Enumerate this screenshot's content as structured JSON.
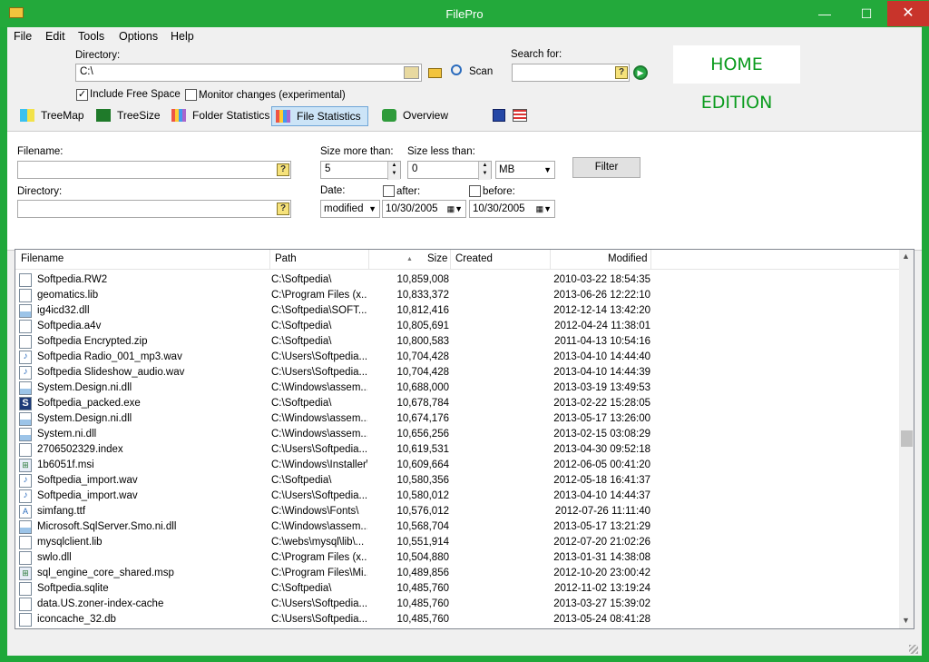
{
  "window": {
    "title": "FilePro",
    "minimize": "—",
    "maximize": "☐",
    "close": "✕"
  },
  "menu": [
    "File",
    "Edit",
    "Tools",
    "Options",
    "Help"
  ],
  "toolbar": {
    "directory_label": "Directory:",
    "directory_value": "C:\\",
    "scan_label": "Scan",
    "search_label": "Search for:",
    "search_value": "",
    "include_free_space": "Include Free Space",
    "monitor_changes": "Monitor changes (experimental)",
    "home_edition": "HOME EDITION"
  },
  "tabs": [
    {
      "label": "TreeMap",
      "active": false
    },
    {
      "label": "TreeSize",
      "active": false
    },
    {
      "label": "Folder Statistics",
      "active": false
    },
    {
      "label": "File Statistics",
      "active": true
    },
    {
      "label": "Overview",
      "active": false
    }
  ],
  "filter": {
    "filename_label": "Filename:",
    "filename_value": "",
    "directory_label": "Directory:",
    "directory_value": "",
    "size_more_label": "Size more than:",
    "size_more_value": "5",
    "size_less_label": "Size less than:",
    "size_less_value": "0",
    "unit": "MB",
    "filter_button": "Filter",
    "date_label": "Date:",
    "date_mode": "modified",
    "after_label": "after:",
    "after_date": "10/30/2005",
    "before_label": "before:",
    "before_date": "10/30/2005",
    "question_mark": "?"
  },
  "table": {
    "columns": [
      "Filename",
      "Path",
      "Size",
      "Created",
      "Modified"
    ],
    "rows": [
      {
        "icon": "file",
        "name": "Softpedia.RW2",
        "path": "C:\\Softpedia\\",
        "size": "10,859,008",
        "created": "",
        "modified": "2010-03-22 18:54:35"
      },
      {
        "icon": "file",
        "name": "geomatics.lib",
        "path": "C:\\Program Files (x...",
        "size": "10,833,372",
        "created": "",
        "modified": "2013-06-26 12:22:10"
      },
      {
        "icon": "dll",
        "name": "ig4icd32.dll",
        "path": "C:\\Softpedia\\SOFT...",
        "size": "10,812,416",
        "created": "",
        "modified": "2012-12-14 13:42:20"
      },
      {
        "icon": "file",
        "name": "Softpedia.a4v",
        "path": "C:\\Softpedia\\",
        "size": "10,805,691",
        "created": "",
        "modified": "2012-04-24 11:38:01"
      },
      {
        "icon": "file",
        "name": "Softpedia Encrypted.zip",
        "path": "C:\\Softpedia\\",
        "size": "10,800,583",
        "created": "",
        "modified": "2011-04-13 10:54:16"
      },
      {
        "icon": "audio",
        "name": "Softpedia Radio_001_mp3.wav",
        "path": "C:\\Users\\Softpedia...",
        "size": "10,704,428",
        "created": "",
        "modified": "2013-04-10 14:44:40"
      },
      {
        "icon": "audio",
        "name": "Softpedia Slideshow_audio.wav",
        "path": "C:\\Users\\Softpedia...",
        "size": "10,704,428",
        "created": "",
        "modified": "2013-04-10 14:44:39"
      },
      {
        "icon": "dll",
        "name": "System.Design.ni.dll",
        "path": "C:\\Windows\\assem...",
        "size": "10,688,000",
        "created": "",
        "modified": "2013-03-19 13:49:53"
      },
      {
        "icon": "exe",
        "name": "Softpedia_packed.exe",
        "path": "C:\\Softpedia\\",
        "size": "10,678,784",
        "created": "",
        "modified": "2013-02-22 15:28:05"
      },
      {
        "icon": "dll",
        "name": "System.Design.ni.dll",
        "path": "C:\\Windows\\assem...",
        "size": "10,674,176",
        "created": "",
        "modified": "2013-05-17 13:26:00"
      },
      {
        "icon": "dll",
        "name": "System.ni.dll",
        "path": "C:\\Windows\\assem...",
        "size": "10,656,256",
        "created": "",
        "modified": "2013-02-15 03:08:29"
      },
      {
        "icon": "file",
        "name": "2706502329.index",
        "path": "C:\\Users\\Softpedia...",
        "size": "10,619,531",
        "created": "",
        "modified": "2013-04-30 09:52:18"
      },
      {
        "icon": "msi",
        "name": "1b6051f.msi",
        "path": "C:\\Windows\\Installer\\",
        "size": "10,609,664",
        "created": "",
        "modified": "2012-06-05 00:41:20"
      },
      {
        "icon": "audio",
        "name": "Softpedia_import.wav",
        "path": "C:\\Softpedia\\",
        "size": "10,580,356",
        "created": "",
        "modified": "2012-05-18 16:41:37"
      },
      {
        "icon": "audio",
        "name": "Softpedia_import.wav",
        "path": "C:\\Users\\Softpedia...",
        "size": "10,580,012",
        "created": "",
        "modified": "2013-04-10 14:44:37"
      },
      {
        "icon": "font",
        "name": "simfang.ttf",
        "path": "C:\\Windows\\Fonts\\",
        "size": "10,576,012",
        "created": "",
        "modified": "2012-07-26 11:11:40"
      },
      {
        "icon": "dll",
        "name": "Microsoft.SqlServer.Smo.ni.dll",
        "path": "C:\\Windows\\assem...",
        "size": "10,568,704",
        "created": "",
        "modified": "2013-05-17 13:21:29"
      },
      {
        "icon": "file",
        "name": "mysqlclient.lib",
        "path": "C:\\webs\\mysql\\lib\\...",
        "size": "10,551,914",
        "created": "",
        "modified": "2012-07-20 21:02:26"
      },
      {
        "icon": "file",
        "name": "swlo.dll",
        "path": "C:\\Program Files (x...",
        "size": "10,504,880",
        "created": "",
        "modified": "2013-01-31 14:38:08"
      },
      {
        "icon": "msi",
        "name": "sql_engine_core_shared.msp",
        "path": "C:\\Program Files\\Mi...",
        "size": "10,489,856",
        "created": "",
        "modified": "2012-10-20 23:00:42"
      },
      {
        "icon": "file",
        "name": "Softpedia.sqlite",
        "path": "C:\\Softpedia\\",
        "size": "10,485,760",
        "created": "",
        "modified": "2012-11-02 13:19:24"
      },
      {
        "icon": "file",
        "name": "data.US.zoner-index-cache",
        "path": "C:\\Users\\Softpedia...",
        "size": "10,485,760",
        "created": "",
        "modified": "2013-03-27 15:39:02"
      },
      {
        "icon": "file",
        "name": "iconcache_32.db",
        "path": "C:\\Users\\Softpedia...",
        "size": "10,485,760",
        "created": "",
        "modified": "2013-05-24 08:41:28"
      }
    ]
  }
}
